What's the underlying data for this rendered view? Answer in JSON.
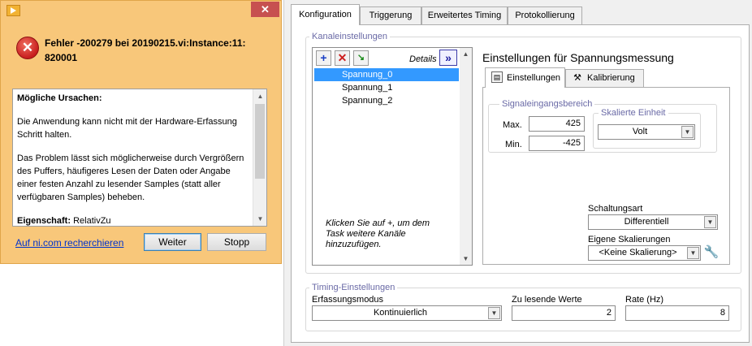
{
  "dialog": {
    "title": "Fehler -200279 bei 20190215.vi:Instance:11: 820001",
    "close_glyph": "✕",
    "error_glyph": "✕",
    "heading": "Mögliche Ursachen:",
    "para1": "Die Anwendung kann nicht mit der Hardware-Erfassung Schritt halten.",
    "para2": "Das Problem lässt sich möglicherweise durch Vergrößern des Puffers, häufigeres Lesen der Daten oder Angabe einer festen Anzahl zu lesender Samples (statt aller verfügbaren Samples) beheben.",
    "property_label": "Eigenschaft:",
    "property_value": "RelativZu",
    "link": "Auf ni.com recherchieren",
    "continue_button": "Weiter",
    "stop_button": "Stopp"
  },
  "tabs": [
    {
      "label": "Konfiguration",
      "active": true
    },
    {
      "label": "Triggerung"
    },
    {
      "label": "Erweitertes Timing"
    },
    {
      "label": "Protokollierung"
    }
  ],
  "channels": {
    "group_label": "Kanaleinstellungen",
    "add_glyph": "+",
    "remove_glyph": "✕",
    "details_label": "Details",
    "expand_glyph": "»",
    "items": [
      "Spannung_0",
      "Spannung_1",
      "Spannung_2"
    ],
    "selected_index": 0,
    "hint": "Klicken Sie auf +, um dem Task weitere Kanäle hinzuzufügen."
  },
  "measurement": {
    "title": "Einstellungen für Spannungsmessung",
    "subtabs": [
      {
        "label": "Einstellungen",
        "active": true
      },
      {
        "label": "Kalibrierung"
      }
    ],
    "signal_range_label": "Signaleingangsbereich",
    "max_label": "Max.",
    "max_value": "425",
    "min_label": "Min.",
    "min_value": "-425",
    "scaled_unit_label": "Skalierte Einheit",
    "scaled_unit_value": "Volt",
    "terminal_config_label": "Schaltungsart",
    "terminal_config_value": "Differentiell",
    "custom_scaling_label": "Eigene Skalierungen",
    "custom_scaling_value": "<Keine Skalierung>"
  },
  "timing": {
    "group_label": "Timing-Einstellungen",
    "mode_label": "Erfassungsmodus",
    "mode_value": "Kontinuierlich",
    "samples_label": "Zu lesende Werte",
    "samples_value": "2",
    "rate_label": "Rate (Hz)",
    "rate_value": "8"
  },
  "colors": {
    "dialog_bg": "#f8c77a",
    "selection": "#3399ff",
    "group_label": "#6a6aa6",
    "link": "#0033cc"
  }
}
